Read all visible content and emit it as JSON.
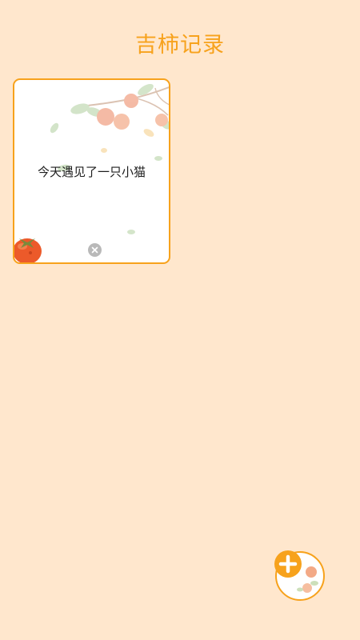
{
  "app": {
    "title": "吉柿记录"
  },
  "notes": [
    {
      "text": "今天遇见了一只小猫"
    }
  ],
  "colors": {
    "background": "#ffe7cd",
    "accent": "#f7a21c",
    "persimmon": "#ec5a2a",
    "delete_button": "#b9b9b9"
  },
  "icons": {
    "delete": "close-circle-icon",
    "add": "plus-circle-icon",
    "card_decoration": "persimmon-branch-illustration"
  }
}
